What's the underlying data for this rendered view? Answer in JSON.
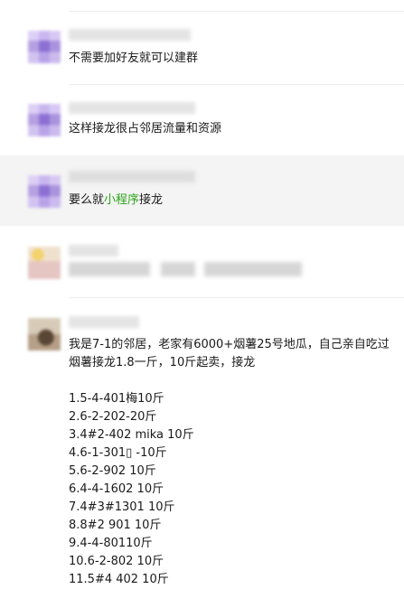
{
  "comments": [
    {
      "text": "不需要加好友就可以建群"
    },
    {
      "text": "这样接龙很占邻居流量和资源"
    },
    {
      "text_before": "要么就",
      "link": "小程序",
      "text_after": "接龙",
      "link_color": "#2aa515"
    }
  ],
  "post": {
    "lines": [
      "我是7-1的邻居，老家有6000+烟薯25号地瓜，自己亲自吃过",
      "烟薯接龙1.8一斤，10斤起卖，接龙"
    ],
    "list": [
      "1.5-4-401梅10斤",
      "2.6-2-202-20斤",
      "3.4#2-402 mika 10斤",
      "4.6-1-301▯ -10斤",
      "5.6-2-902 10斤",
      "6.4-4-1602  10斤",
      "7.4#3#1301  10斤",
      "8.8#2 901 10斤",
      "9.4-4-80110斤",
      "10.6-2-802 10斤",
      "11.5#4 402 10斤"
    ]
  },
  "colors": {
    "highlight_row": "#f4f4f4",
    "link": "#2aa515",
    "divider": "#ececec"
  }
}
